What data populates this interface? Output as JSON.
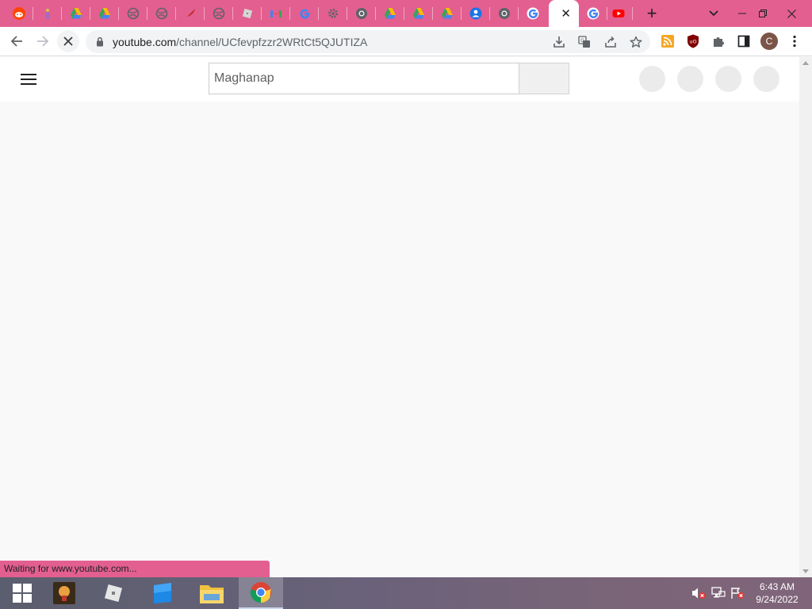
{
  "browser": {
    "active_tab_close": "✕",
    "new_tab": "+",
    "window_controls": {
      "minimize": "–",
      "restore": "❐",
      "close": "✕"
    },
    "address": {
      "host": "youtube.com",
      "path": "/channel/UCfevpfzzr2WRtCt5QJUTIZA"
    },
    "profile_initial": "C",
    "status_text": "Waiting for www.youtube.com..."
  },
  "tabs": [
    {
      "icon": "reddit-icon",
      "color": "#ff4500"
    },
    {
      "icon": "figure-icon",
      "color": "#9b59b6"
    },
    {
      "icon": "google-drive-icon",
      "color": "#34a853"
    },
    {
      "icon": "google-drive-icon",
      "color": "#34a853"
    },
    {
      "icon": "globe-icon",
      "color": "#5f6368"
    },
    {
      "icon": "globe-icon",
      "color": "#5f6368"
    },
    {
      "icon": "red-feather-icon",
      "color": "#c62828"
    },
    {
      "icon": "globe-icon",
      "color": "#5f6368"
    },
    {
      "icon": "roblox-icon",
      "color": "#bdbdbd"
    },
    {
      "icon": "gmail-icon",
      "color": "#ea4335"
    },
    {
      "icon": "google-icon",
      "color": "#4285f4"
    },
    {
      "icon": "settings-icon",
      "color": "#5f6368"
    },
    {
      "icon": "chrome-icon",
      "color": "#5f6368"
    },
    {
      "icon": "google-drive-icon",
      "color": "#34a853"
    },
    {
      "icon": "google-drive-icon",
      "color": "#34a853"
    },
    {
      "icon": "google-drive-icon",
      "color": "#34a853"
    },
    {
      "icon": "account-icon",
      "color": "#1a73e8"
    },
    {
      "icon": "chrome-icon",
      "color": "#5f6368"
    },
    {
      "icon": "google-icon",
      "color": "#4285f4"
    },
    {
      "icon": "google-icon",
      "color": "#4285f4",
      "active": true
    },
    {
      "icon": "google-icon",
      "color": "#4285f4"
    },
    {
      "icon": "youtube-icon",
      "color": "#ff0000"
    }
  ],
  "youtube": {
    "search_value": "Maghanap"
  },
  "taskbar": {
    "apps": [
      "start-icon",
      "app-icon",
      "roblox-icon",
      "blue-app-icon",
      "file-explorer-icon",
      "chrome-icon"
    ],
    "time": "6:43 AM",
    "date": "9/24/2022"
  },
  "colors": {
    "tabstrip": "#e35f8f",
    "page_bg": "#f9f9f9",
    "skeleton": "#ebebeb"
  }
}
